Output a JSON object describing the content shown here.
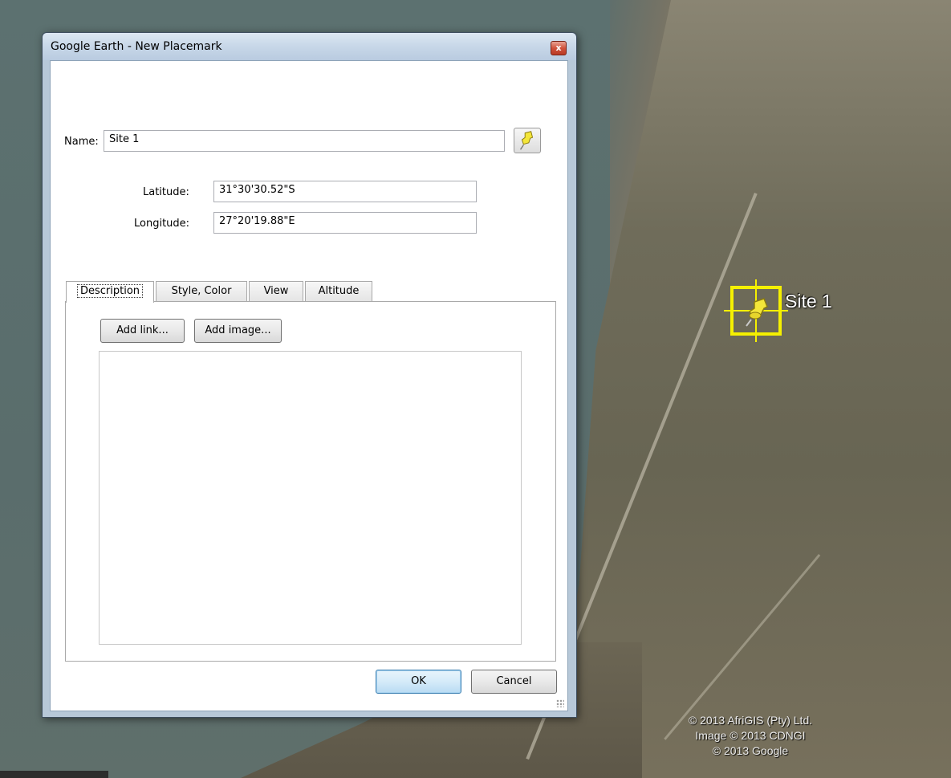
{
  "window": {
    "title": "Google Earth - New Placemark",
    "close_label": "x"
  },
  "form": {
    "name_label": "Name:",
    "name_value": "Site 1",
    "latitude_label": "Latitude:",
    "latitude_value": "31°30'30.52\"S",
    "longitude_label": "Longitude:",
    "longitude_value": "27°20'19.88\"E",
    "icon_button_icon": "pushpin-icon"
  },
  "tabs": [
    {
      "label": "Description",
      "active": true
    },
    {
      "label": "Style, Color",
      "active": false
    },
    {
      "label": "View",
      "active": false
    },
    {
      "label": "Altitude",
      "active": false
    }
  ],
  "description": {
    "add_link_label": "Add link...",
    "add_image_label": "Add image...",
    "text": ""
  },
  "buttons": {
    "ok_label": "OK",
    "cancel_label": "Cancel"
  },
  "map": {
    "placemark_label": "Site 1",
    "placemark_color": "#f5f000",
    "attribution": [
      "© 2013 AfriGIS (Pty) Ltd.",
      "Image © 2013 CDNGI",
      "© 2013 Google"
    ]
  }
}
